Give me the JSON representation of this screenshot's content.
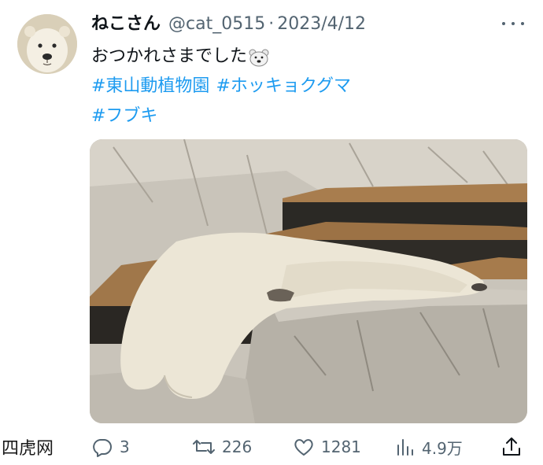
{
  "tweet": {
    "display_name": "ねこさん",
    "handle": "@cat_0515",
    "separator": "·",
    "date": "2023/4/12",
    "text_line1": "おつかれさまでした",
    "emoji_icon": "polar-bear-face-emoji",
    "hashtags": [
      "#東山動植物園",
      "#ホッキョクグマ",
      "#フブキ"
    ]
  },
  "actions": {
    "replies": "3",
    "retweets": "226",
    "likes": "1281",
    "views": "4.9万"
  },
  "colors": {
    "accent": "#1d9bf0",
    "secondary_text": "#536471",
    "primary_text": "#0f1419"
  },
  "watermark": "四虎网"
}
